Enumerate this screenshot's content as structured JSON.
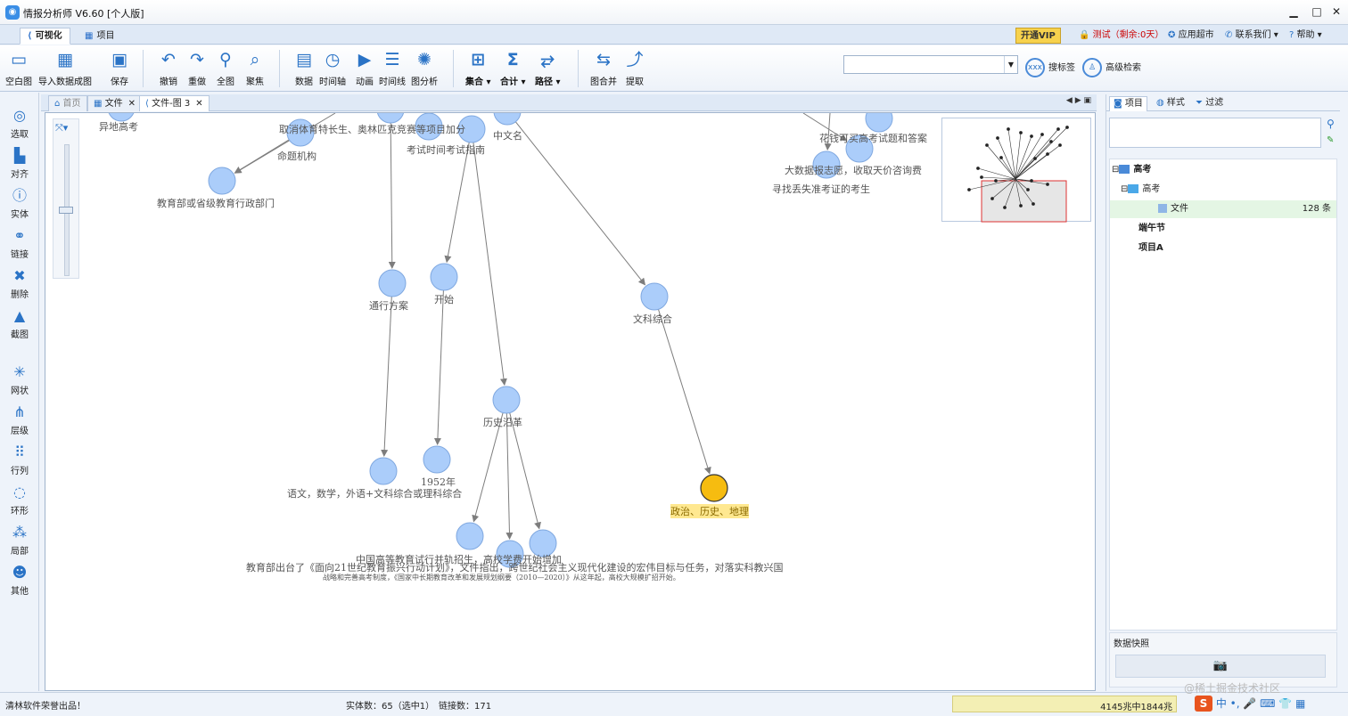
{
  "window": {
    "title": "情报分析师 V6.60 [个人版]",
    "min": "▁",
    "max": "□",
    "close": "✕"
  },
  "ribbon_tabs": [
    {
      "label": "可视化",
      "active": true
    },
    {
      "label": "项目",
      "active": false
    }
  ],
  "topright": {
    "vip": "开通VIP",
    "trial": "测试（剩余:0天）",
    "app_market": "应用超市",
    "contact": "联系我们",
    "help": "帮助"
  },
  "ribbon": {
    "buttons": [
      {
        "label": "空白图",
        "icon": "blank-doc-icon",
        "glyph": "▭"
      },
      {
        "label": "导入数据成图",
        "icon": "import-table-icon",
        "glyph": "▦"
      },
      {
        "label": "保存",
        "icon": "save-icon",
        "glyph": "▣"
      },
      {
        "label": "撤销",
        "icon": "undo-icon",
        "glyph": "↶"
      },
      {
        "label": "重做",
        "icon": "redo-icon",
        "glyph": "↷"
      },
      {
        "label": "全图",
        "icon": "zoom-fit-icon",
        "glyph": "⚲"
      },
      {
        "label": "聚焦",
        "icon": "focus-icon",
        "glyph": "⌕"
      },
      {
        "label": "数据",
        "icon": "data-grid-icon",
        "glyph": "▤"
      },
      {
        "label": "时间轴",
        "icon": "clock-icon",
        "glyph": "◷"
      },
      {
        "label": "动画",
        "icon": "play-icon",
        "glyph": "▶"
      },
      {
        "label": "时间线",
        "icon": "timeline-icon",
        "glyph": "☰"
      },
      {
        "label": "图分析",
        "icon": "graph-analysis-icon",
        "glyph": "✺"
      },
      {
        "label": "集合",
        "icon": "set-icon",
        "glyph": "⊞"
      },
      {
        "label": "合计",
        "icon": "sum-icon",
        "glyph": "Σ"
      },
      {
        "label": "路径",
        "icon": "path-icon",
        "glyph": "⥂"
      },
      {
        "label": "图合并",
        "icon": "merge-icon",
        "glyph": "⇆"
      },
      {
        "label": "提取",
        "icon": "extract-icon",
        "glyph": "⤴"
      }
    ],
    "search_placeholder": "",
    "search_tag": "搜标签",
    "advanced_search": "高级检索",
    "search_glyph": "xxx"
  },
  "left_toolbar": [
    {
      "label": "选取",
      "icon": "select-icon",
      "glyph": "◎"
    },
    {
      "label": "对齐",
      "icon": "align-icon",
      "glyph": "▙"
    },
    {
      "label": "实体",
      "icon": "entity-icon",
      "glyph": "ⓘ"
    },
    {
      "label": "链接",
      "icon": "link-icon",
      "glyph": "⚭"
    },
    {
      "label": "删除",
      "icon": "delete-icon",
      "glyph": "✖"
    },
    {
      "label": "截图",
      "icon": "screenshot-icon",
      "glyph": "▲"
    },
    {
      "label": "网状",
      "icon": "network-layout-icon",
      "glyph": "✳"
    },
    {
      "label": "层级",
      "icon": "hierarchy-layout-icon",
      "glyph": "⋔"
    },
    {
      "label": "行列",
      "icon": "grid-layout-icon",
      "glyph": "⠿"
    },
    {
      "label": "环形",
      "icon": "circle-layout-icon",
      "glyph": "◌"
    },
    {
      "label": "局部",
      "icon": "local-layout-icon",
      "glyph": "⁂"
    },
    {
      "label": "其他",
      "icon": "other-layout-icon",
      "glyph": "☻"
    }
  ],
  "doc_tabs": [
    {
      "label": "首页",
      "active": false
    },
    {
      "label": "文件",
      "active": false
    },
    {
      "label": "文件-图 3",
      "active": true
    }
  ],
  "graph": {
    "node_color": "#abcdfa",
    "node_stroke": "#7fa8e0",
    "selected_color": "#f6bc10",
    "edge_color": "#7d7d7d",
    "labels": [
      {
        "id": "n1",
        "text": "异地高考"
      },
      {
        "id": "n2",
        "text": "取消体育特长生、奥林匹克竞赛等项目加分"
      },
      {
        "id": "n3",
        "text": "命题机构"
      },
      {
        "id": "n4",
        "text": "考试时间考试指南"
      },
      {
        "id": "n5",
        "text": "中文名"
      },
      {
        "id": "n6",
        "text": "花钱可买高考试题和答案"
      },
      {
        "id": "n7",
        "text": "大数据报志愿，收取天价咨询费"
      },
      {
        "id": "n8",
        "text": "寻找丢失准考证的考生"
      },
      {
        "id": "n9",
        "text": "教育部或省级教育行政部门"
      },
      {
        "id": "n10",
        "text": "通行方案"
      },
      {
        "id": "n11",
        "text": "开始"
      },
      {
        "id": "n12",
        "text": "文科综合"
      },
      {
        "id": "n13",
        "text": "历史沿革"
      },
      {
        "id": "n14",
        "text": "1952年"
      },
      {
        "id": "n15",
        "text": "语文，数学，外语+文科综合或理科综合"
      },
      {
        "id": "n16",
        "text": "政治、历史、地理"
      },
      {
        "id": "n17",
        "text": "中国高等教育试行并轨招生，高校学费开始增加"
      },
      {
        "id": "n18",
        "text": "教育部出台了《面向21世纪教育振兴行动计划》，文件指出，跨世纪社会主义现代化建设的宏伟目标与任务，对落实科教兴国"
      },
      {
        "id": "n19",
        "text": "战略和完善高考制度，《国家中长期教育改革和发展规划纲要（2010—2020）》从这年起，高校大规模扩招开始。"
      }
    ]
  },
  "right_panel": {
    "tabs": [
      {
        "label": "项目",
        "active": true
      },
      {
        "label": "样式",
        "active": false
      },
      {
        "label": "过滤",
        "active": false
      }
    ],
    "tree": [
      {
        "label": "高考",
        "level": 0,
        "bold": true
      },
      {
        "label": "高考",
        "level": 1,
        "bold": false
      },
      {
        "label": "文件",
        "level": 2,
        "count": "128 条",
        "selected": true
      },
      {
        "label": "端午节",
        "level": 0,
        "bold": true
      },
      {
        "label": "项目A",
        "level": 0,
        "bold": true
      }
    ],
    "snapshot_title": "数据快照",
    "snapshot_glyph": "📷"
  },
  "status": {
    "left": "清林软件荣誉出品！",
    "entities": "实体数：65（选中1）",
    "links": "链接数：171",
    "memory": "4145兆中1844兆",
    "watermark": "@稀土掘金技术社区"
  }
}
